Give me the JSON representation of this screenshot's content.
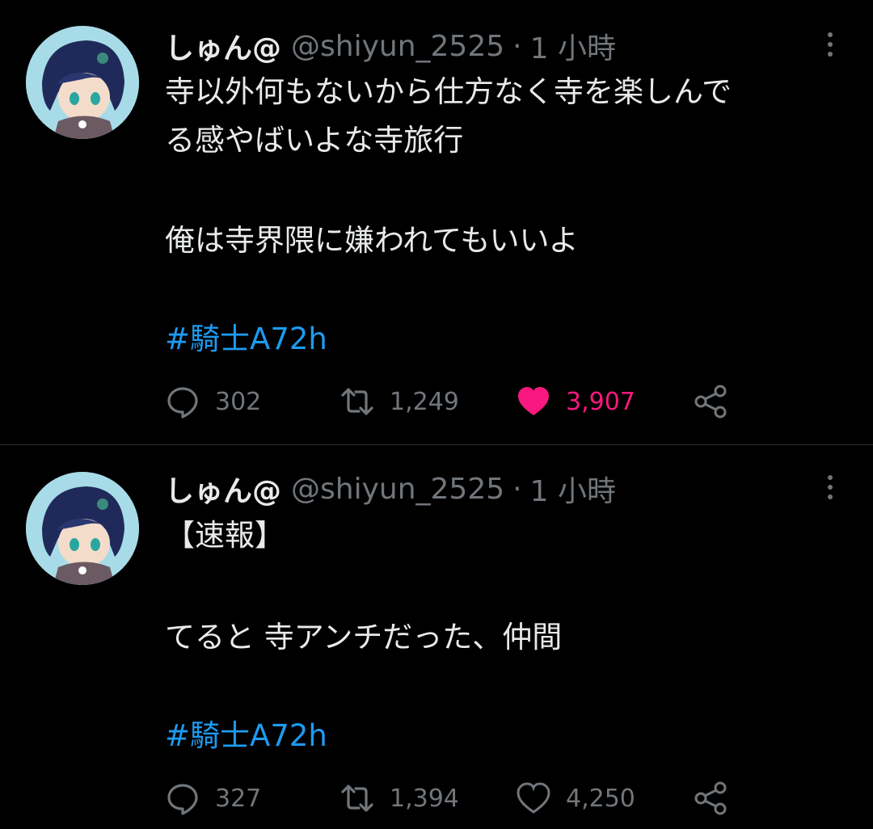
{
  "colors": {
    "background": "#000000",
    "text": "#e7e9ea",
    "muted": "#71767b",
    "link": "#1d9bf0",
    "like_active": "#f91880"
  },
  "tweets": [
    {
      "display_name": "しゅん@",
      "handle": "@shiyun_2525",
      "separator": "·",
      "time": "1 小時",
      "lines": [
        "寺以外何もないから仕方なく寺を楽しんで",
        "る感やばいよな寺旅行",
        "",
        "俺は寺界隈に嫌われてもいいよ"
      ],
      "hashtag": "#騎士A72h",
      "replies": "302",
      "retweets": "1,249",
      "likes": "3,907",
      "liked": true,
      "icons": [
        "reply-icon",
        "retweet-icon",
        "heart-filled-icon",
        "share-icon",
        "more-icon"
      ]
    },
    {
      "display_name": "しゅん@",
      "handle": "@shiyun_2525",
      "separator": "·",
      "time": "1 小時",
      "lines": [
        "【速報】",
        "",
        "てると 寺アンチだった、仲間"
      ],
      "hashtag": "#騎士A72h",
      "replies": "327",
      "retweets": "1,394",
      "likes": "4,250",
      "liked": false,
      "icons": [
        "reply-icon",
        "retweet-icon",
        "heart-outline-icon",
        "share-icon",
        "more-icon"
      ]
    }
  ]
}
